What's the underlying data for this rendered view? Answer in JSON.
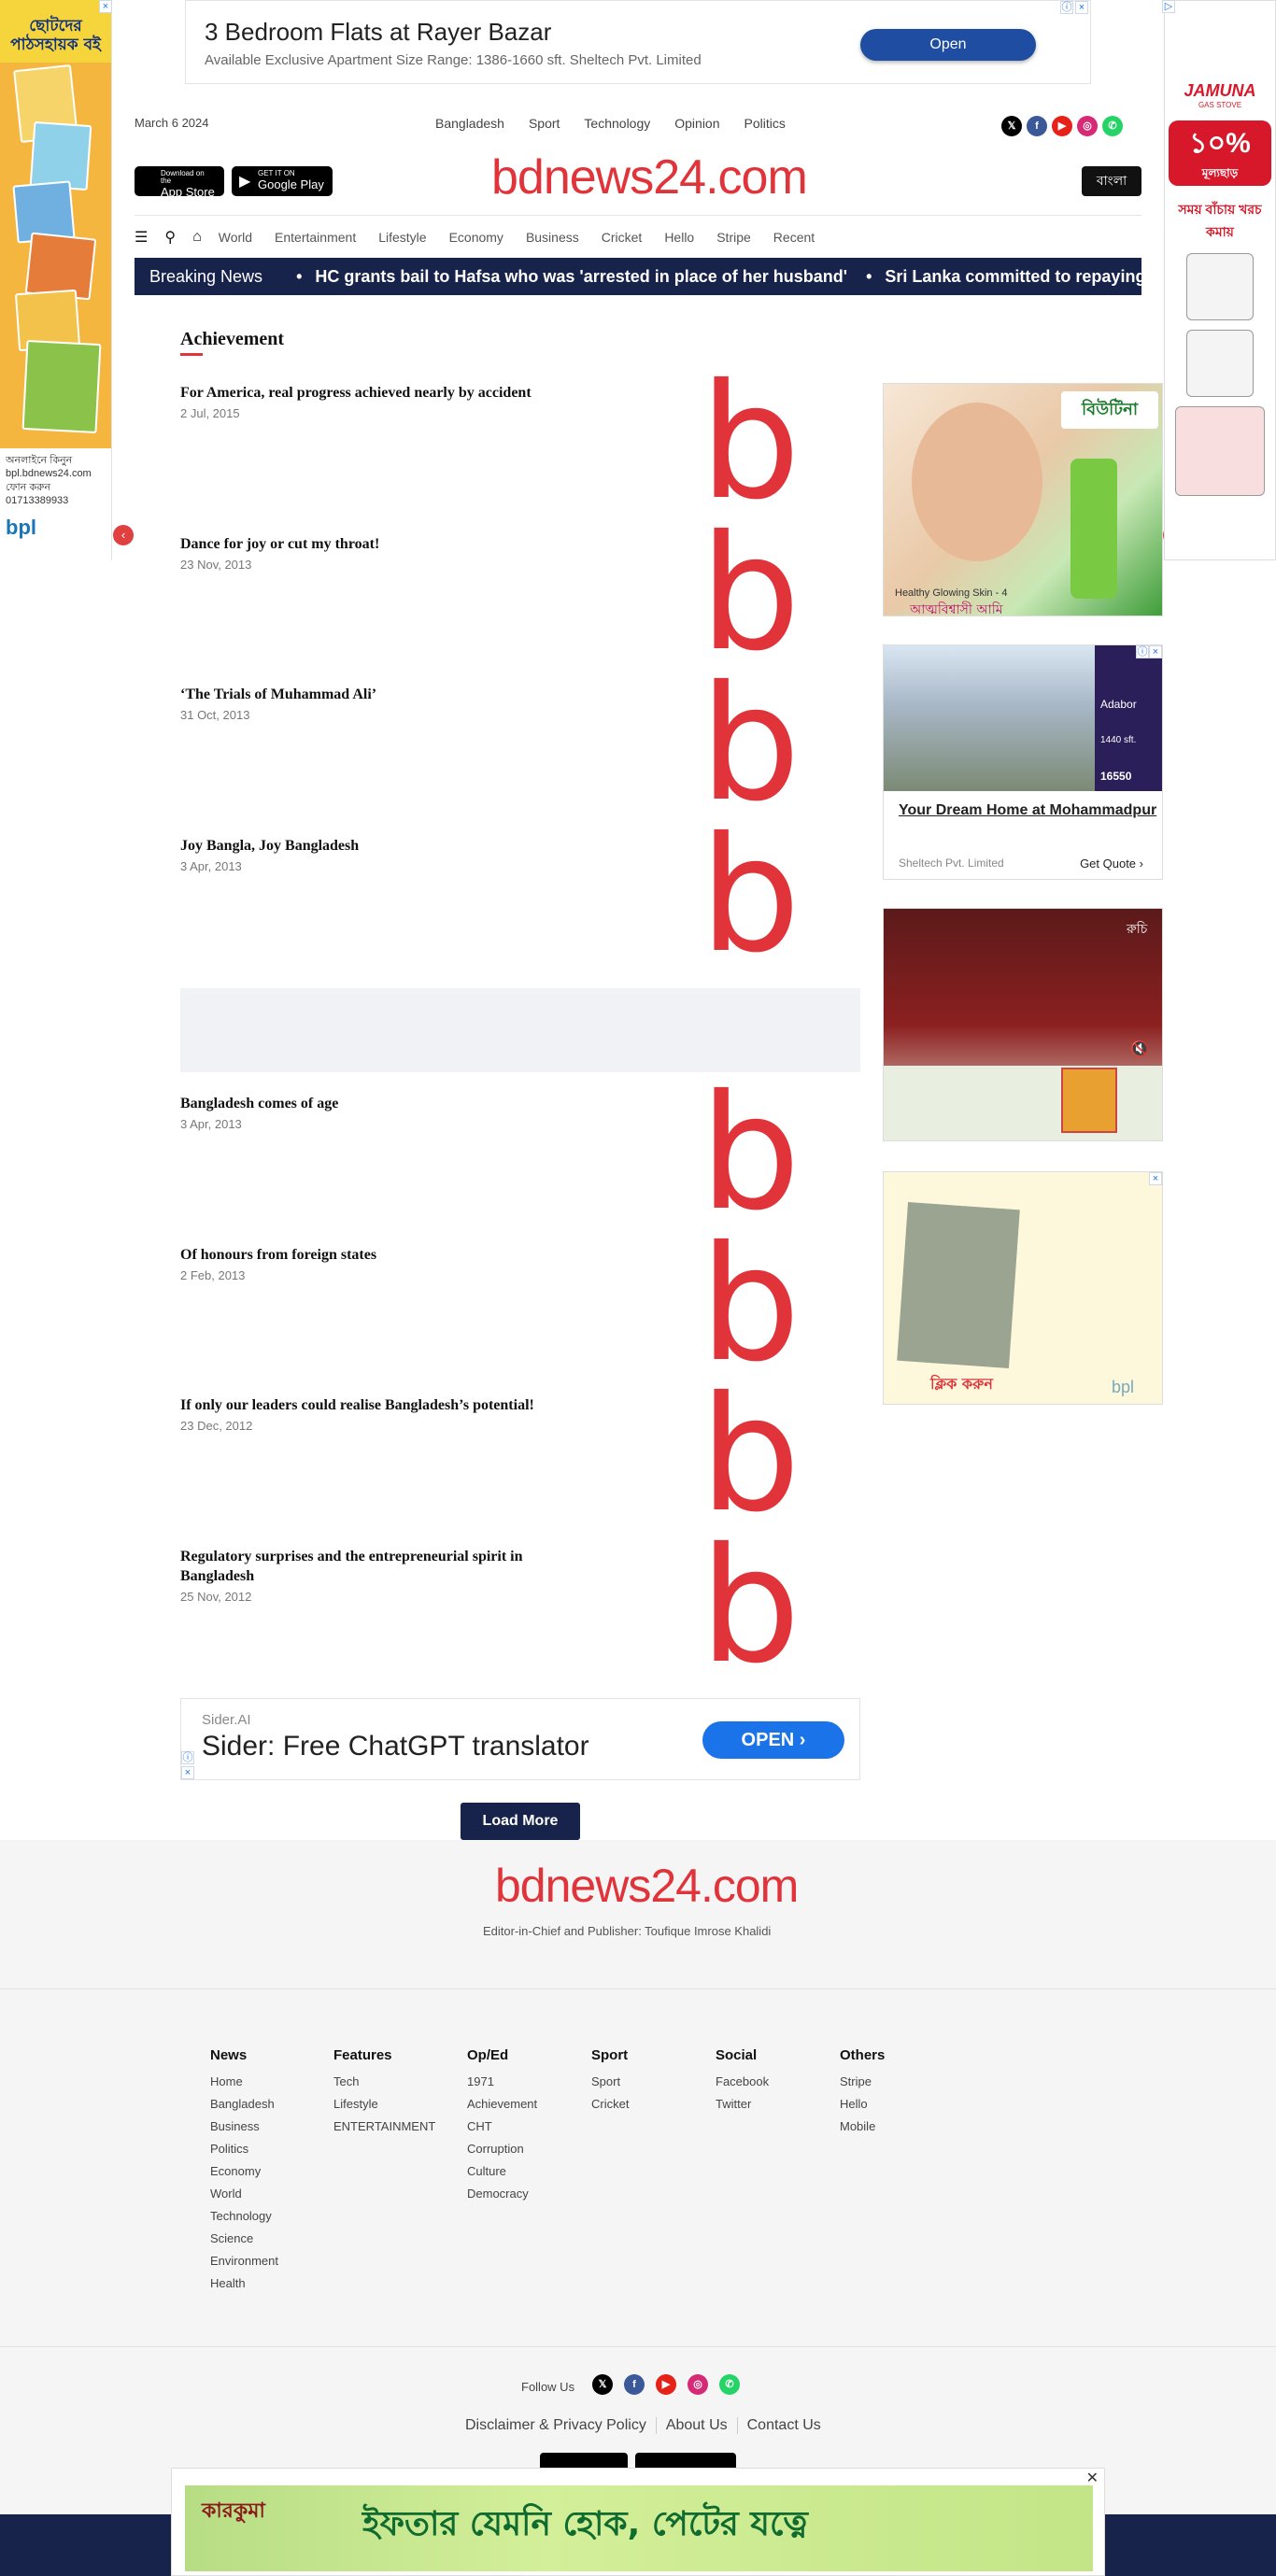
{
  "ads": {
    "top_banner": {
      "title": "3 Bedroom Flats at Rayer Bazar",
      "subtitle": "Available Exclusive Apartment Size Range: 1386-1660 sft. Sheltech Pvt. Limited",
      "button": "Open"
    },
    "left_sky": {
      "title": "ছোটদের পাঠসহায়ক বই",
      "line1": "অনলাইনে কিনুন",
      "line2": "bpl.bdnews24.com",
      "line3": "ফোন করুন",
      "phone": "01713389933",
      "logo": "bpl"
    },
    "right_sky": {
      "brand": "JAMUNA",
      "brand_sub": "GAS STOVE",
      "percent": "১০%",
      "percent_sub": "মূল্যছাড়",
      "tag": "সময় বাঁচায় খরচ কমায়"
    },
    "rc1": {
      "brand": "বিউটিনা",
      "text1": "Healthy Glowing Skin - 4",
      "text2": "আত্মবিশ্বাসী আমি"
    },
    "rc2": {
      "side_brand": "Adabor",
      "side_size": "1440 sft.",
      "side_phone": "16550",
      "title": "Your Dream Home at Mohammadpur",
      "source": "Sheltech Pvt. Limited",
      "cta": "Get Quote"
    },
    "rc3": {
      "label": "রুচি"
    },
    "rc4": {
      "cta": "ক্লিক করুন",
      "logo": "bpl"
    },
    "sider": {
      "source": "Sider.AI",
      "title": "Sider: Free ChatGPT translator",
      "button": "OPEN"
    },
    "bottom": {
      "brand": "কারকুমা",
      "slogan": "ইফতার যেমনি হোক, পেটের যত্নে"
    }
  },
  "header": {
    "date": "March 6 2024",
    "top_nav": [
      "Bangladesh",
      "Sport",
      "Technology",
      "Opinion",
      "Politics"
    ],
    "logo": "bdnews24.com",
    "language_button": "বাংলা",
    "app_store": {
      "small": "Download on the",
      "label": "App Store"
    },
    "google_play": {
      "small": "GET IT ON",
      "label": "Google Play"
    }
  },
  "menu": [
    "World",
    "Entertainment",
    "Lifestyle",
    "Economy",
    "Business",
    "Cricket",
    "Hello",
    "Stripe",
    "Recent"
  ],
  "ticker": {
    "label": "Breaking News",
    "items": [
      "HC grants bail to Hafsa who was 'arrested in place of her husband'",
      "Sri Lanka committed to repaying"
    ]
  },
  "section": {
    "title": "Achievement",
    "articles": [
      {
        "title": "For America, real progress achieved nearly by accident",
        "date": "2 Jul, 2015"
      },
      {
        "title": "Dance for joy or cut my throat!",
        "date": "23 Nov, 2013"
      },
      {
        "title": "‘The Trials of Muhammad Ali’",
        "date": "31 Oct, 2013"
      },
      {
        "title": "Joy Bangla, Joy Bangladesh",
        "date": "3 Apr, 2013"
      },
      {
        "title": "Bangladesh comes of age",
        "date": "3 Apr, 2013"
      },
      {
        "title": "Of honours from foreign states",
        "date": "2 Feb, 2013"
      },
      {
        "title": "If only our leaders could realise Bangladesh’s potential!",
        "date": "23 Dec, 2012"
      },
      {
        "title": "Regulatory surprises and the entrepreneurial spirit in Bangladesh",
        "date": "25 Nov, 2012"
      }
    ],
    "thumb_letter": "b",
    "load_more": "Load More"
  },
  "footer": {
    "logo": "bdnews24.com",
    "editor": "Editor-in-Chief and Publisher: Toufique Imrose Khalidi",
    "columns": [
      {
        "title": "News",
        "items": [
          "Home",
          "Bangladesh",
          "Business",
          "Politics",
          "Economy",
          "World",
          "Technology",
          "Science",
          "Environment",
          "Health"
        ]
      },
      {
        "title": "Features",
        "items": [
          "Tech",
          "Lifestyle",
          "ENTERTAINMENT"
        ]
      },
      {
        "title": "Op/Ed",
        "items": [
          "1971",
          "Achievement",
          "CHT",
          "Corruption",
          "Culture",
          "Democracy"
        ]
      },
      {
        "title": "Sport",
        "items": [
          "Sport",
          "Cricket"
        ]
      },
      {
        "title": "Social",
        "items": [
          "Facebook",
          "Twitter"
        ]
      },
      {
        "title": "Others",
        "items": [
          "Stripe",
          "Hello",
          "Mobile"
        ]
      }
    ],
    "follow_label": "Follow Us",
    "links": [
      "Disclaimer & Privacy Policy",
      "About Us",
      "Contact Us"
    ]
  },
  "colors": {
    "brand_red": "#e0343a",
    "navy": "#17234a"
  }
}
